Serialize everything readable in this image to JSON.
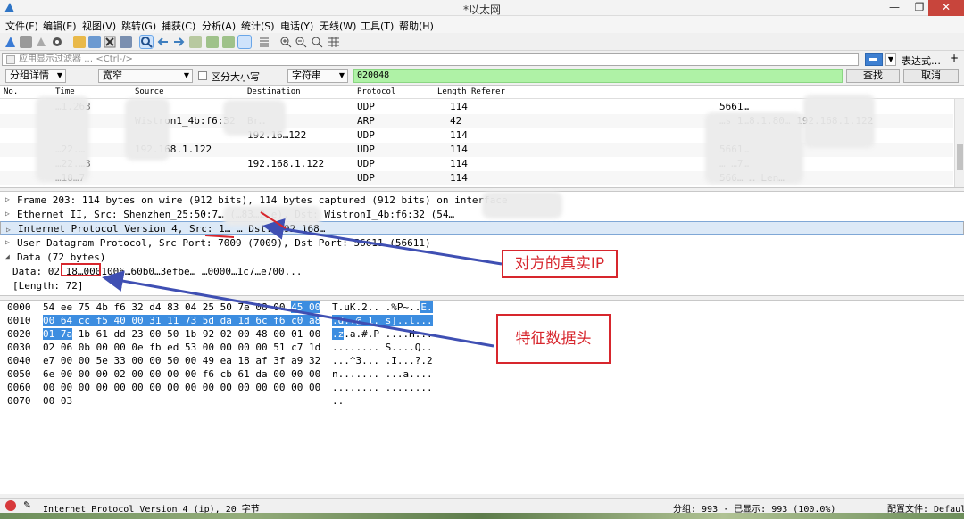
{
  "window": {
    "title": "*以太网",
    "min": "—",
    "max": "❐",
    "close": "✕"
  },
  "menu": [
    "文件(F)",
    "编辑(E)",
    "视图(V)",
    "跳转(G)",
    "捕获(C)",
    "分析(A)",
    "统计(S)",
    "电话(Y)",
    "无线(W)",
    "工具(T)",
    "帮助(H)"
  ],
  "filter": {
    "placeholder": "应用显示过滤器 … <Ctrl-/>",
    "expression_label": "表达式…",
    "plus": "+"
  },
  "search": {
    "pane_select": "分组详情",
    "width_select": "宽窄",
    "case_label": "区分大小写",
    "type_select": "字符串",
    "value": "020048",
    "find_button": "查找",
    "cancel_button": "取消"
  },
  "packet_list": {
    "columns": [
      "No.",
      "Time",
      "Source",
      "Destination",
      "Protocol",
      "Length",
      "Referer"
    ],
    "rows": [
      {
        "time": "…1.263",
        "source": "",
        "destination": "",
        "protocol": "UDP",
        "length": "114",
        "info": "5661…"
      },
      {
        "time": "",
        "source": "Wistron1_4b:f6:32",
        "destination": "Br…",
        "protocol": "ARP",
        "length": "42",
        "info": "…s 1…8.1.80…   192.168.1.122"
      },
      {
        "time": "",
        "source": "",
        "destination": "192.16…122",
        "protocol": "UDP",
        "length": "114",
        "info": ""
      },
      {
        "time": "…22.…",
        "source": "192.168.1.122",
        "destination": "",
        "protocol": "UDP",
        "length": "114",
        "info": "5661…"
      },
      {
        "time": "…22.…3",
        "source": "",
        "destination": "192.168.1.122",
        "protocol": "UDP",
        "length": "114",
        "info": "…  …7…"
      },
      {
        "time": "…18…7",
        "source": "",
        "destination": "",
        "protocol": "UDP",
        "length": "114",
        "info": "566…  …  Len…"
      },
      {
        "time": "",
        "source": "",
        "destination": "",
        "protocol": "UDP",
        "length": "114",
        "info": ""
      }
    ]
  },
  "details": [
    {
      "expand": "▷",
      "text": "Frame 203: 114 bytes on wire (912 bits), 114 bytes captured (912 bits) on interface"
    },
    {
      "expand": "▷",
      "text": "Ethernet II, Src: Shenzhen_25:50:7… (…83…2…e), Dst: WistronI_4b:f6:32 (54…"
    },
    {
      "expand": "▷",
      "text": "Internet Protocol Version 4, Src: 1…  …  Dst: 192.168…"
    },
    {
      "expand": "▷",
      "text": "User Datagram Protocol, Src Port: 7009 (7009), Dst Port: 56611 (56611)"
    },
    {
      "expand": "◢",
      "text": "Data (72 bytes)"
    },
    {
      "expand": "",
      "text": "  Data: 02 18…0001006…60b0…3efbe…  …0000…1c7…e700..."
    },
    {
      "expand": "",
      "text": "  [Length: 72]"
    }
  ],
  "hex": [
    {
      "off": "0000",
      "pre": "54 ee 75 4b f6 32 d4 83  04 25 50 7e 08 00 ",
      "hl": "45 00",
      "post": "",
      "asc_pre": "T.uK.2.. .%P~..",
      "asc_hl": "E.",
      "asc_post": ""
    },
    {
      "off": "0010",
      "pre": "",
      "hl": "00 64 cc f5 40 00 31 11  73 5d da 1d 6c f6 c0 a8",
      "post": "",
      "asc_pre": "",
      "asc_hl": ".d..@.1. s]..l...",
      "asc_post": ""
    },
    {
      "off": "0020",
      "pre": "",
      "hl": "01 7a",
      "post": " 1b 61 dd 23 00 50  1b 92 02 00 48 00 01 00",
      "asc_pre": "",
      "asc_hl": ".z",
      "asc_post": ".a.#.P ....H..."
    },
    {
      "off": "0030",
      "pre": "02 06 0b 00 00 0e fb ed  53 00 00 00 00 51 c7 1d",
      "hl": "",
      "post": "",
      "asc_pre": "........ S....Q..",
      "asc_hl": "",
      "asc_post": ""
    },
    {
      "off": "0040",
      "pre": "e7 00 00 5e 33 00 00 50  00 49 ea 18 af 3f a9 32",
      "hl": "",
      "post": "",
      "asc_pre": "...^3... .I...?.2",
      "asc_hl": "",
      "asc_post": ""
    },
    {
      "off": "0050",
      "pre": "6e 00 00 00 02 00 00 00  00 f6 cb 61 da 00 00 00",
      "hl": "",
      "post": "",
      "asc_pre": "n....... ...a....",
      "asc_hl": "",
      "asc_post": ""
    },
    {
      "off": "0060",
      "pre": "00 00 00 00 00 00 00 00  00 00 00 00 00 00 00 00",
      "hl": "",
      "post": "",
      "asc_pre": "........ ........",
      "asc_hl": "",
      "asc_post": ""
    },
    {
      "off": "0070",
      "pre": "00 03",
      "hl": "",
      "post": "",
      "asc_pre": "..",
      "asc_hl": "",
      "asc_post": ""
    }
  ],
  "annotations": {
    "real_ip": "对方的真实IP",
    "header": "特征数据头"
  },
  "status": {
    "field": "Internet Protocol Version 4 (ip), 20 字节",
    "packets": "分组: 993 · 已显示: 993 (100.0%)",
    "profile": "配置文件: Default"
  },
  "colors": {
    "highlight": "#3c8de0",
    "annotation_red": "#d7262d",
    "arrow_blue": "#3f4fb3",
    "search_green": "#aff2a6"
  }
}
